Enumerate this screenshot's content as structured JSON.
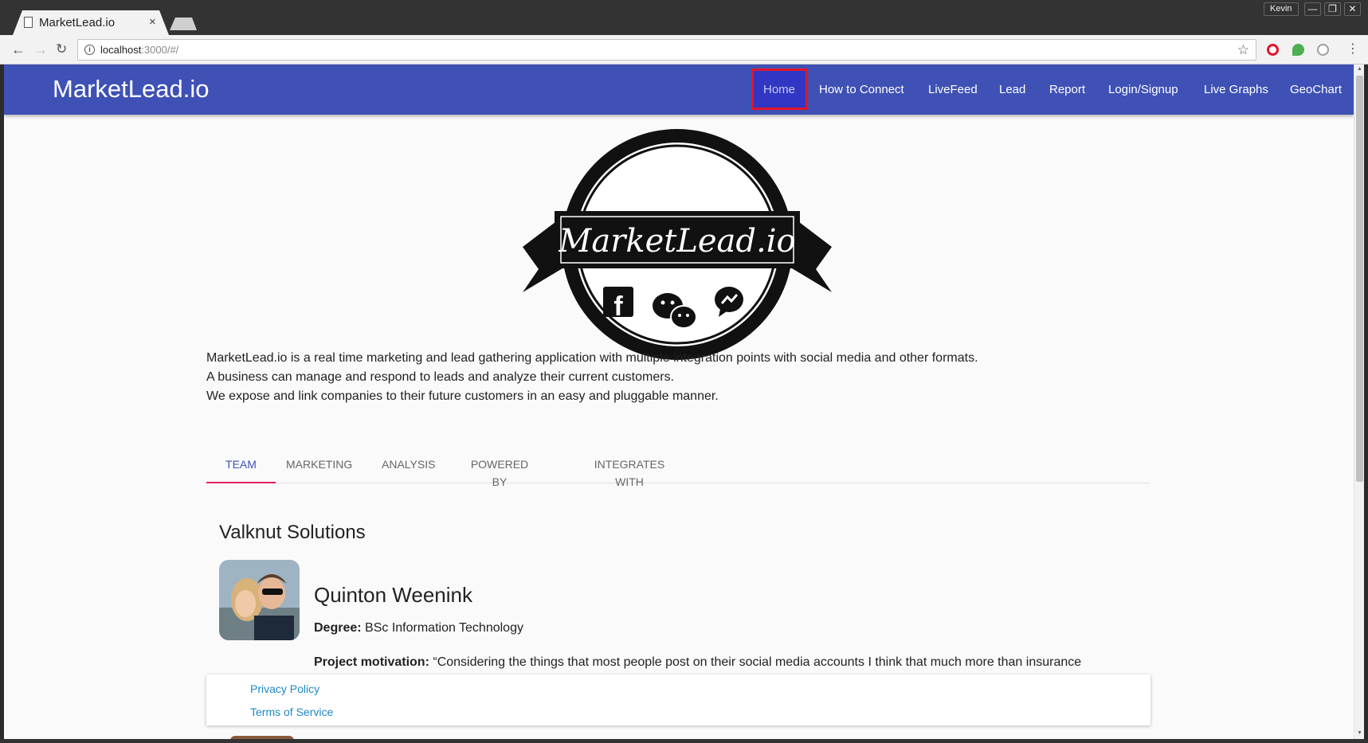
{
  "browser": {
    "tab_title": "MarketLead.io",
    "tab_close": "×",
    "profile_name": "Kevin",
    "window_buttons": [
      "—",
      "❐",
      "✕"
    ],
    "url_host": "localhost",
    "url_path": ":3000/#/",
    "nav_icons": [
      "back-icon",
      "forward-icon",
      "reload-icon"
    ],
    "extension_colors": [
      "#e3142a",
      "#4caf50",
      "#9e9e9e"
    ]
  },
  "app": {
    "brand": "MarketLead.io",
    "accent_color": "#3f51b5",
    "nav": [
      "Home",
      "How to Connect",
      "LiveFeed",
      "Lead",
      "Report",
      "Login/Signup",
      "Live Graphs",
      "GeoChart"
    ],
    "active_nav": "Home"
  },
  "logo": {
    "text": "MarketLead.io",
    "icons": [
      "facebook-icon",
      "wechat-icon",
      "messenger-icon"
    ]
  },
  "intro": {
    "lines": [
      "MarketLead.io is a real time marketing and lead gathering application with multiple integration points with social media and other formats.",
      "A business can manage and respond to leads and analyze their current customers.",
      "We expose and link companies to their future customers in an easy and pluggable manner."
    ]
  },
  "tabs": {
    "items": [
      "TEAM",
      "MARKETING",
      "ANALYSIS",
      "POWERED BY",
      "INTEGRATES WITH"
    ],
    "active": "TEAM"
  },
  "team": {
    "title": "Valknut Solutions",
    "member": {
      "name": "Quinton Weenink",
      "degree_label": "Degree:",
      "degree": "BSc Information Technology",
      "motivation_label": "Project motivation:",
      "motivation": "“Considering the things that most people post on their social media accounts I think that much more than insurance"
    }
  },
  "footer": {
    "links": [
      "Privacy Policy",
      "Terms of Service"
    ]
  }
}
